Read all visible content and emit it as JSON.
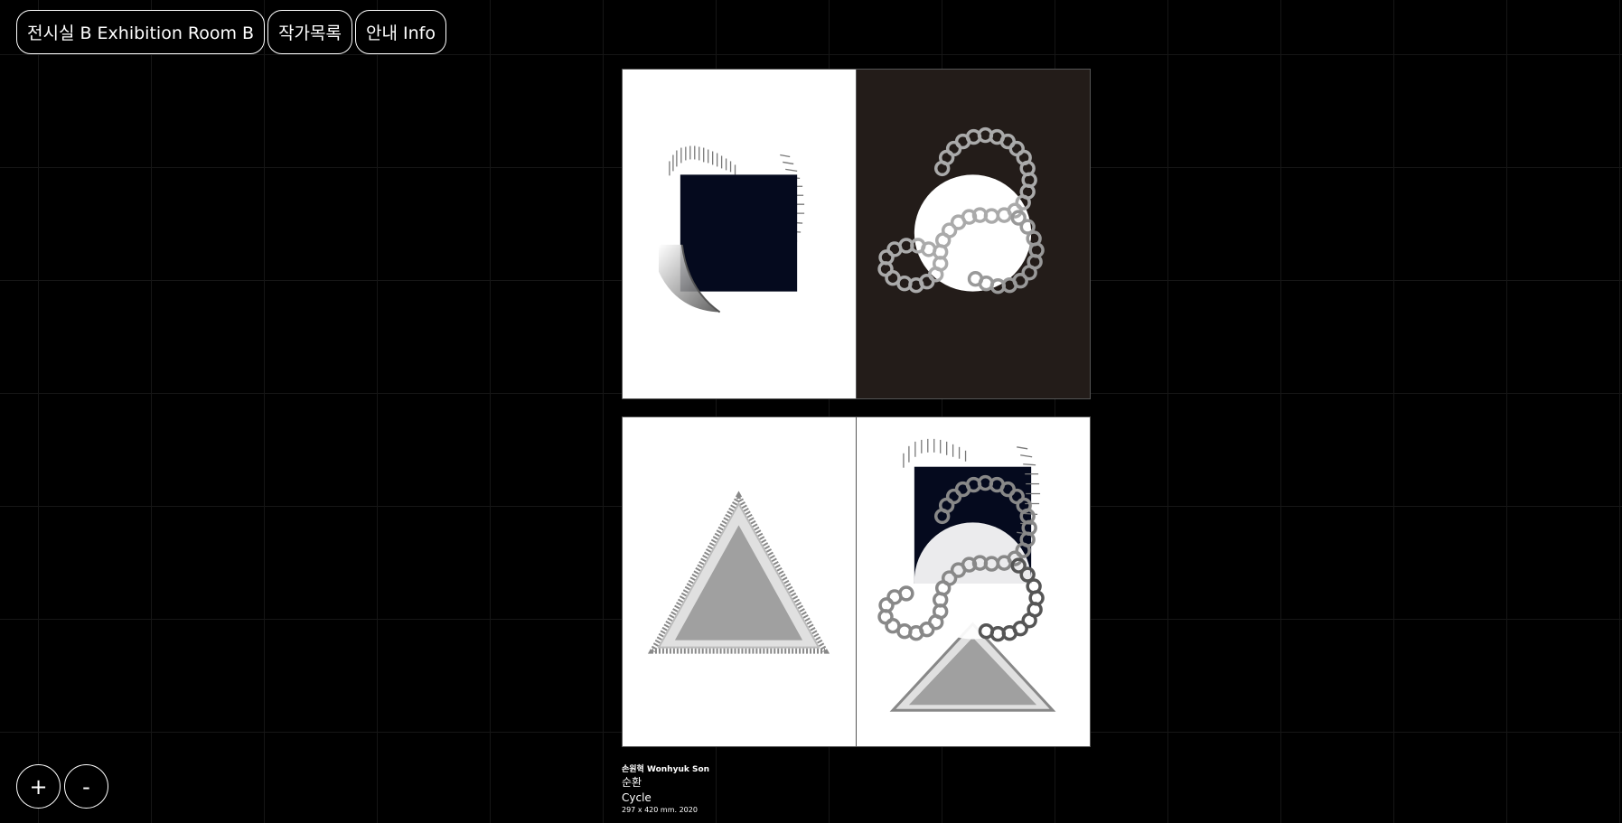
{
  "nav": {
    "items": [
      {
        "label": "전시실 B Exhibition Room B"
      },
      {
        "label": "작가목록"
      },
      {
        "label": "안내 Info"
      }
    ]
  },
  "zoom": {
    "in_label": "+",
    "out_label": "-"
  },
  "caption": {
    "artist": "손원혁 Wonhyuk Son",
    "title_ko": "순환",
    "title_en": "Cycle",
    "meta": "297 x 420 mm. 2020"
  },
  "colors": {
    "background": "#000000",
    "grid_line": "#161616",
    "paper_white": "#ffffff",
    "paper_dark": "#231c19",
    "navy_square": "#050a1e",
    "triangle_gray": "#a0a0a0"
  }
}
